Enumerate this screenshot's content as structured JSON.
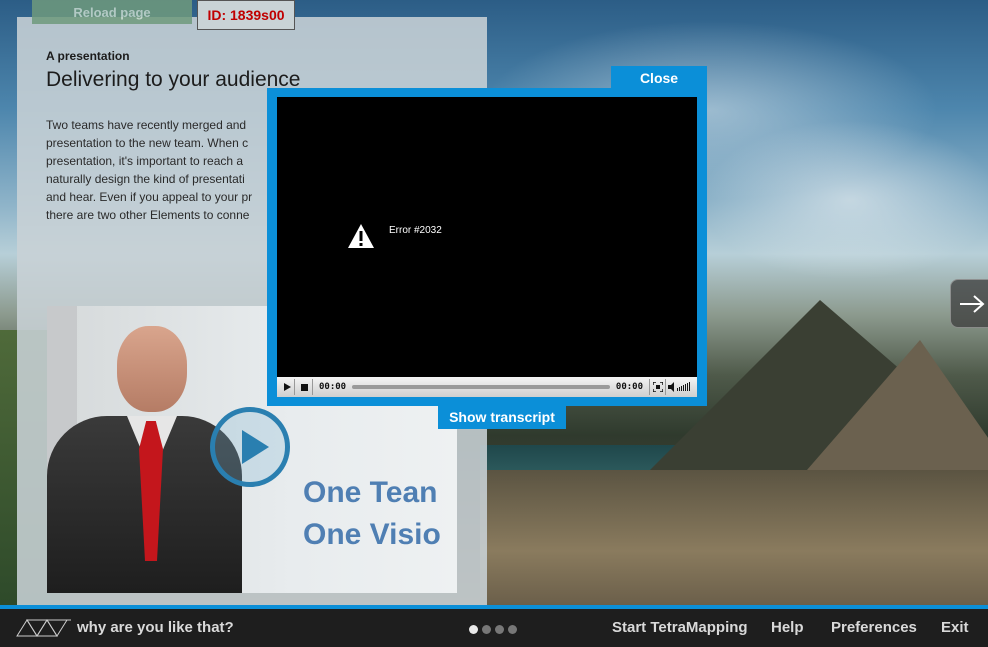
{
  "header": {
    "reload_label": "Reload page",
    "id_label": "ID: 1839s00"
  },
  "content": {
    "eyebrow": "A presentation",
    "title": "Delivering to your audience",
    "body": "Two teams have recently merged and\npresentation to the new team. When c\npresentation, it's important to reach a\nnaturally design the kind of presentati\nand hear. Even if you appeal to your pr\nthere are two other Elements to conne"
  },
  "thumbnail": {
    "slide_text": "One Tean\nOne Visio"
  },
  "video_modal": {
    "close_label": "Close",
    "error_text": "Error #2032",
    "time_current": "00:00",
    "time_total": "00:00",
    "transcript_label": "Show transcript"
  },
  "footer": {
    "tagline": "why are you like that?",
    "pages": 4,
    "active_page": 1,
    "nav": {
      "start": "Start TetraMapping",
      "help": "Help",
      "preferences": "Preferences",
      "exit": "Exit"
    }
  },
  "colors": {
    "accent": "#0b8fd8",
    "error_id": "#c00000",
    "footer_bg": "#1e1e1e"
  }
}
